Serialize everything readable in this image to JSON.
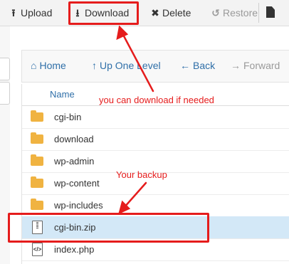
{
  "toolbar": {
    "upload": "Upload",
    "download": "Download",
    "delete": "Delete",
    "restore": "Restore"
  },
  "nav": {
    "home": "Home",
    "up_one_level": "Up One Level",
    "back": "Back",
    "forward": "Forward"
  },
  "table": {
    "header_name": "Name",
    "rows": [
      {
        "name": "cgi-bin",
        "type": "folder"
      },
      {
        "name": "download",
        "type": "folder"
      },
      {
        "name": "wp-admin",
        "type": "folder"
      },
      {
        "name": "wp-content",
        "type": "folder"
      },
      {
        "name": "wp-includes",
        "type": "folder"
      },
      {
        "name": "cgi-bin.zip",
        "type": "zip",
        "selected": true
      },
      {
        "name": "index.php",
        "type": "php"
      }
    ]
  },
  "annotations": {
    "download_note": "you can download if needed",
    "backup_note": "Your backup",
    "color": "#e51c1c"
  },
  "icons": {
    "upload": "upload-icon",
    "download": "download-icon",
    "delete": "delete-x-icon",
    "restore": "restore-icon",
    "home": "home-icon",
    "up": "up-arrow-icon",
    "back": "back-arrow-icon",
    "forward": "forward-arrow-icon",
    "folder": "folder-icon"
  },
  "colors": {
    "link": "#2f6fa8",
    "folder": "#f0b341",
    "selected_row": "#d3e8f7"
  }
}
